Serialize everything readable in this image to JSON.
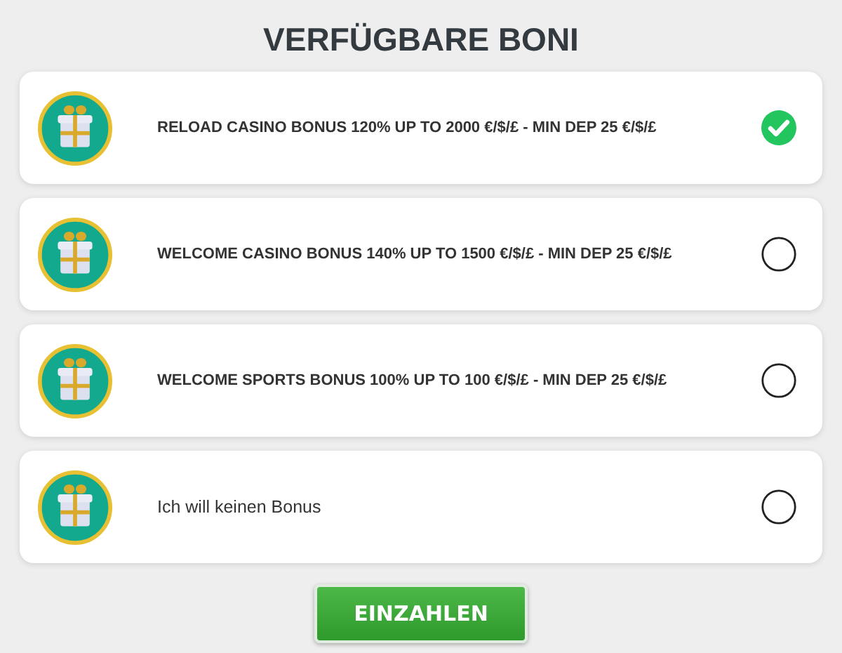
{
  "title": "VERFÜGBARE BONI",
  "options": [
    {
      "kind": "bonus",
      "label": "RELOAD CASINO BONUS 120% UP TO 2000 €/$/£ - MIN DEP 25 €/$/£",
      "selected": true
    },
    {
      "kind": "bonus",
      "label": "WELCOME CASINO BONUS 140% UP TO 1500 €/$/£ - MIN DEP 25 €/$/£",
      "selected": false
    },
    {
      "kind": "bonus",
      "label": "WELCOME SPORTS BONUS 100% UP TO 100 €/$/£ - MIN DEP 25 €/$/£",
      "selected": false
    },
    {
      "kind": "none",
      "label": "Ich will keinen Bonus",
      "selected": false
    }
  ],
  "button": "EINZAHLEN"
}
